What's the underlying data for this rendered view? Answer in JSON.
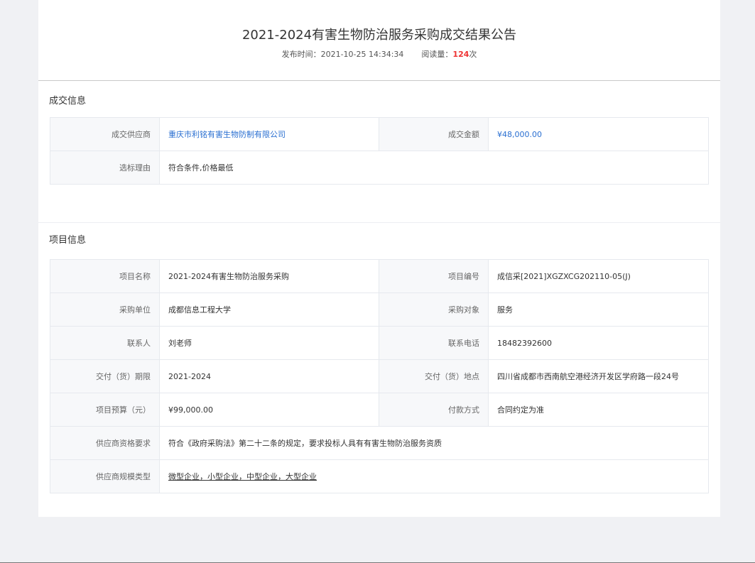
{
  "notice": {
    "title": "2021-2024有害生物防治服务采购成交结果公告",
    "publish_label": "发布时间：",
    "publish_time": "2021-10-25 14:34:34",
    "read_label": "阅读量：",
    "read_count": "124",
    "read_unit": "次"
  },
  "deal": {
    "section_title": "成交信息",
    "supplier_label": "成交供应商",
    "supplier_value": "重庆市利铭有害生物防制有限公司",
    "amount_label": "成交金额",
    "amount_value": "¥48,000.00",
    "reason_label": "选标理由",
    "reason_value": "符合条件,价格最低"
  },
  "project": {
    "section_title": "项目信息",
    "name_label": "项目名称",
    "name_value": "2021-2024有害生物防治服务采购",
    "code_label": "项目编号",
    "code_value": "成信采[2021]XGZXCG202110-05(J)",
    "buyer_label": "采购单位",
    "buyer_value": "成都信息工程大学",
    "object_label": "采购对象",
    "object_value": "服务",
    "contact_label": "联系人",
    "contact_value": "刘老师",
    "phone_label": "联系电话",
    "phone_value": "18482392600",
    "period_label": "交付（货）期限",
    "period_value": "2021-2024",
    "place_label": "交付（货）地点",
    "place_value": "四川省成都市西南航空港经济开发区学府路一段24号",
    "budget_label": "项目预算（元）",
    "budget_value": "¥99,000.00",
    "payment_label": "付款方式",
    "payment_value": "合同约定为准",
    "qualification_label": "供应商资格要求",
    "qualification_value": "符合《政府采购法》第二十二条的规定，要求投标人具有有害生物防治服务资质",
    "scale_label": "供应商规模类型",
    "scale_value": "微型企业，小型企业，中型企业，大型企业"
  }
}
